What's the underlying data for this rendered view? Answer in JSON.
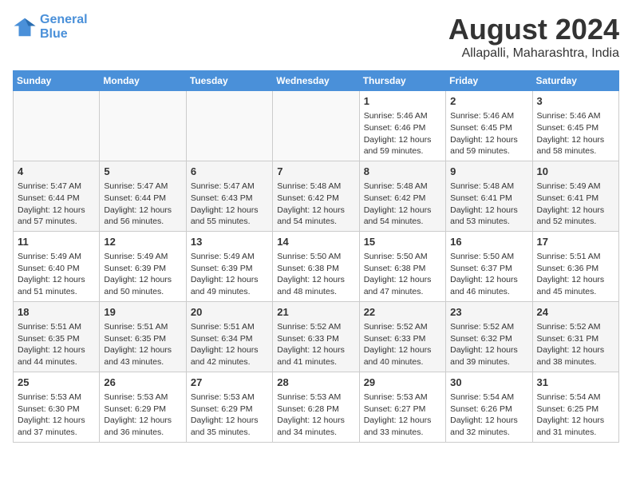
{
  "header": {
    "logo_line1": "General",
    "logo_line2": "Blue",
    "main_title": "August 2024",
    "sub_title": "Allapalli, Maharashtra, India"
  },
  "days_of_week": [
    "Sunday",
    "Monday",
    "Tuesday",
    "Wednesday",
    "Thursday",
    "Friday",
    "Saturday"
  ],
  "weeks": [
    [
      {
        "day": "",
        "info": ""
      },
      {
        "day": "",
        "info": ""
      },
      {
        "day": "",
        "info": ""
      },
      {
        "day": "",
        "info": ""
      },
      {
        "day": "1",
        "sunrise": "5:46 AM",
        "sunset": "6:46 PM",
        "daylight": "12 hours and 59 minutes."
      },
      {
        "day": "2",
        "sunrise": "5:46 AM",
        "sunset": "6:45 PM",
        "daylight": "12 hours and 59 minutes."
      },
      {
        "day": "3",
        "sunrise": "5:46 AM",
        "sunset": "6:45 PM",
        "daylight": "12 hours and 58 minutes."
      }
    ],
    [
      {
        "day": "4",
        "sunrise": "5:47 AM",
        "sunset": "6:44 PM",
        "daylight": "12 hours and 57 minutes."
      },
      {
        "day": "5",
        "sunrise": "5:47 AM",
        "sunset": "6:44 PM",
        "daylight": "12 hours and 56 minutes."
      },
      {
        "day": "6",
        "sunrise": "5:47 AM",
        "sunset": "6:43 PM",
        "daylight": "12 hours and 55 minutes."
      },
      {
        "day": "7",
        "sunrise": "5:48 AM",
        "sunset": "6:42 PM",
        "daylight": "12 hours and 54 minutes."
      },
      {
        "day": "8",
        "sunrise": "5:48 AM",
        "sunset": "6:42 PM",
        "daylight": "12 hours and 54 minutes."
      },
      {
        "day": "9",
        "sunrise": "5:48 AM",
        "sunset": "6:41 PM",
        "daylight": "12 hours and 53 minutes."
      },
      {
        "day": "10",
        "sunrise": "5:49 AM",
        "sunset": "6:41 PM",
        "daylight": "12 hours and 52 minutes."
      }
    ],
    [
      {
        "day": "11",
        "sunrise": "5:49 AM",
        "sunset": "6:40 PM",
        "daylight": "12 hours and 51 minutes."
      },
      {
        "day": "12",
        "sunrise": "5:49 AM",
        "sunset": "6:39 PM",
        "daylight": "12 hours and 50 minutes."
      },
      {
        "day": "13",
        "sunrise": "5:49 AM",
        "sunset": "6:39 PM",
        "daylight": "12 hours and 49 minutes."
      },
      {
        "day": "14",
        "sunrise": "5:50 AM",
        "sunset": "6:38 PM",
        "daylight": "12 hours and 48 minutes."
      },
      {
        "day": "15",
        "sunrise": "5:50 AM",
        "sunset": "6:38 PM",
        "daylight": "12 hours and 47 minutes."
      },
      {
        "day": "16",
        "sunrise": "5:50 AM",
        "sunset": "6:37 PM",
        "daylight": "12 hours and 46 minutes."
      },
      {
        "day": "17",
        "sunrise": "5:51 AM",
        "sunset": "6:36 PM",
        "daylight": "12 hours and 45 minutes."
      }
    ],
    [
      {
        "day": "18",
        "sunrise": "5:51 AM",
        "sunset": "6:35 PM",
        "daylight": "12 hours and 44 minutes."
      },
      {
        "day": "19",
        "sunrise": "5:51 AM",
        "sunset": "6:35 PM",
        "daylight": "12 hours and 43 minutes."
      },
      {
        "day": "20",
        "sunrise": "5:51 AM",
        "sunset": "6:34 PM",
        "daylight": "12 hours and 42 minutes."
      },
      {
        "day": "21",
        "sunrise": "5:52 AM",
        "sunset": "6:33 PM",
        "daylight": "12 hours and 41 minutes."
      },
      {
        "day": "22",
        "sunrise": "5:52 AM",
        "sunset": "6:33 PM",
        "daylight": "12 hours and 40 minutes."
      },
      {
        "day": "23",
        "sunrise": "5:52 AM",
        "sunset": "6:32 PM",
        "daylight": "12 hours and 39 minutes."
      },
      {
        "day": "24",
        "sunrise": "5:52 AM",
        "sunset": "6:31 PM",
        "daylight": "12 hours and 38 minutes."
      }
    ],
    [
      {
        "day": "25",
        "sunrise": "5:53 AM",
        "sunset": "6:30 PM",
        "daylight": "12 hours and 37 minutes."
      },
      {
        "day": "26",
        "sunrise": "5:53 AM",
        "sunset": "6:29 PM",
        "daylight": "12 hours and 36 minutes."
      },
      {
        "day": "27",
        "sunrise": "5:53 AM",
        "sunset": "6:29 PM",
        "daylight": "12 hours and 35 minutes."
      },
      {
        "day": "28",
        "sunrise": "5:53 AM",
        "sunset": "6:28 PM",
        "daylight": "12 hours and 34 minutes."
      },
      {
        "day": "29",
        "sunrise": "5:53 AM",
        "sunset": "6:27 PM",
        "daylight": "12 hours and 33 minutes."
      },
      {
        "day": "30",
        "sunrise": "5:54 AM",
        "sunset": "6:26 PM",
        "daylight": "12 hours and 32 minutes."
      },
      {
        "day": "31",
        "sunrise": "5:54 AM",
        "sunset": "6:25 PM",
        "daylight": "12 hours and 31 minutes."
      }
    ]
  ]
}
